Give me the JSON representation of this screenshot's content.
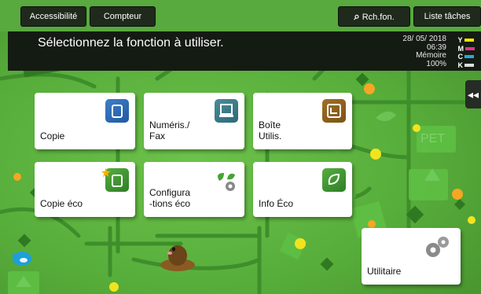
{
  "topbar": {
    "accessibility_label": "Accessibilité",
    "counter_label": "Compteur",
    "search_label": "Rch.fon.",
    "jobs_label": "Liste tâches"
  },
  "message": "Sélectionnez la fonction à utiliser.",
  "status": {
    "date": "28/ 05/ 2018",
    "time": "06:39",
    "memory_label": "Mémoire",
    "memory_value": "100%"
  },
  "toner": [
    {
      "letter": "Y",
      "color": "#f2e400"
    },
    {
      "letter": "M",
      "color": "#e0338d"
    },
    {
      "letter": "C",
      "color": "#2aa6e0"
    },
    {
      "letter": "K",
      "color": "#dddddd"
    }
  ],
  "tiles": {
    "copy": "Copie",
    "scan_fax_line1": "Numéris./",
    "scan_fax_line2": "Fax",
    "user_box_line1": "Boîte",
    "user_box_line2": "Utilis.",
    "eco_copy": "Copie éco",
    "eco_config_line1": "Configura",
    "eco_config_line2": "-tions éco",
    "eco_info": "Info Éco",
    "utility": "Utilitaire"
  },
  "side_button_glyph": "◂◂",
  "colors": {
    "background": "#57ad3a",
    "dark_bar": "#141b13",
    "tile": "#ffffff"
  }
}
